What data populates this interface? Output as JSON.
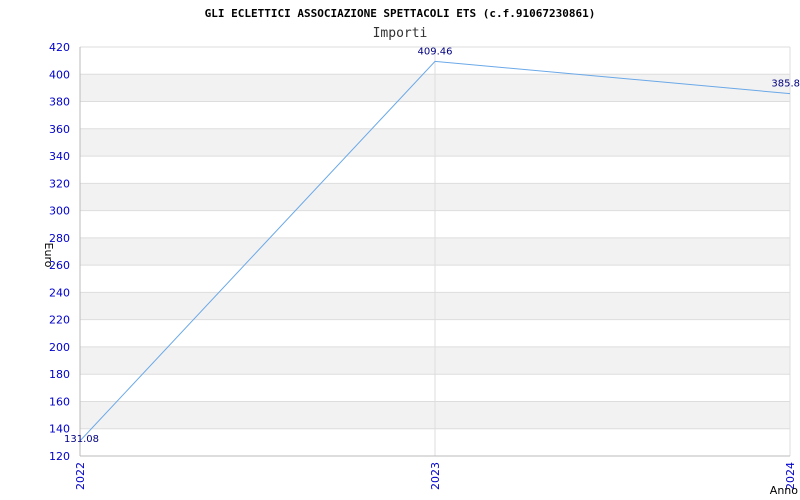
{
  "chart_data": {
    "type": "line",
    "title": "GLI ECLETTICI ASSOCIAZIONE SPETTACOLI ETS (c.f.91067230861)",
    "subtitle": "Importi",
    "xlabel": "Anno",
    "ylabel": "Euro",
    "x": [
      "2022",
      "2023",
      "2024"
    ],
    "series": [
      {
        "values": [
          131.08,
          409.46,
          385.8
        ],
        "labels": [
          "131.08",
          "409.46",
          "385.8"
        ],
        "color": "#6aa8e8"
      }
    ],
    "ylim": [
      120,
      420
    ],
    "yticks": [
      "120",
      "140",
      "160",
      "180",
      "200",
      "220",
      "240",
      "260",
      "280",
      "300",
      "320",
      "340",
      "360",
      "380",
      "400",
      "420"
    ],
    "grid": true,
    "band_colors": [
      "#ffffff",
      "#f2f2f2"
    ],
    "grid_color": "#dddddd",
    "tick_color": "#0000cc"
  }
}
